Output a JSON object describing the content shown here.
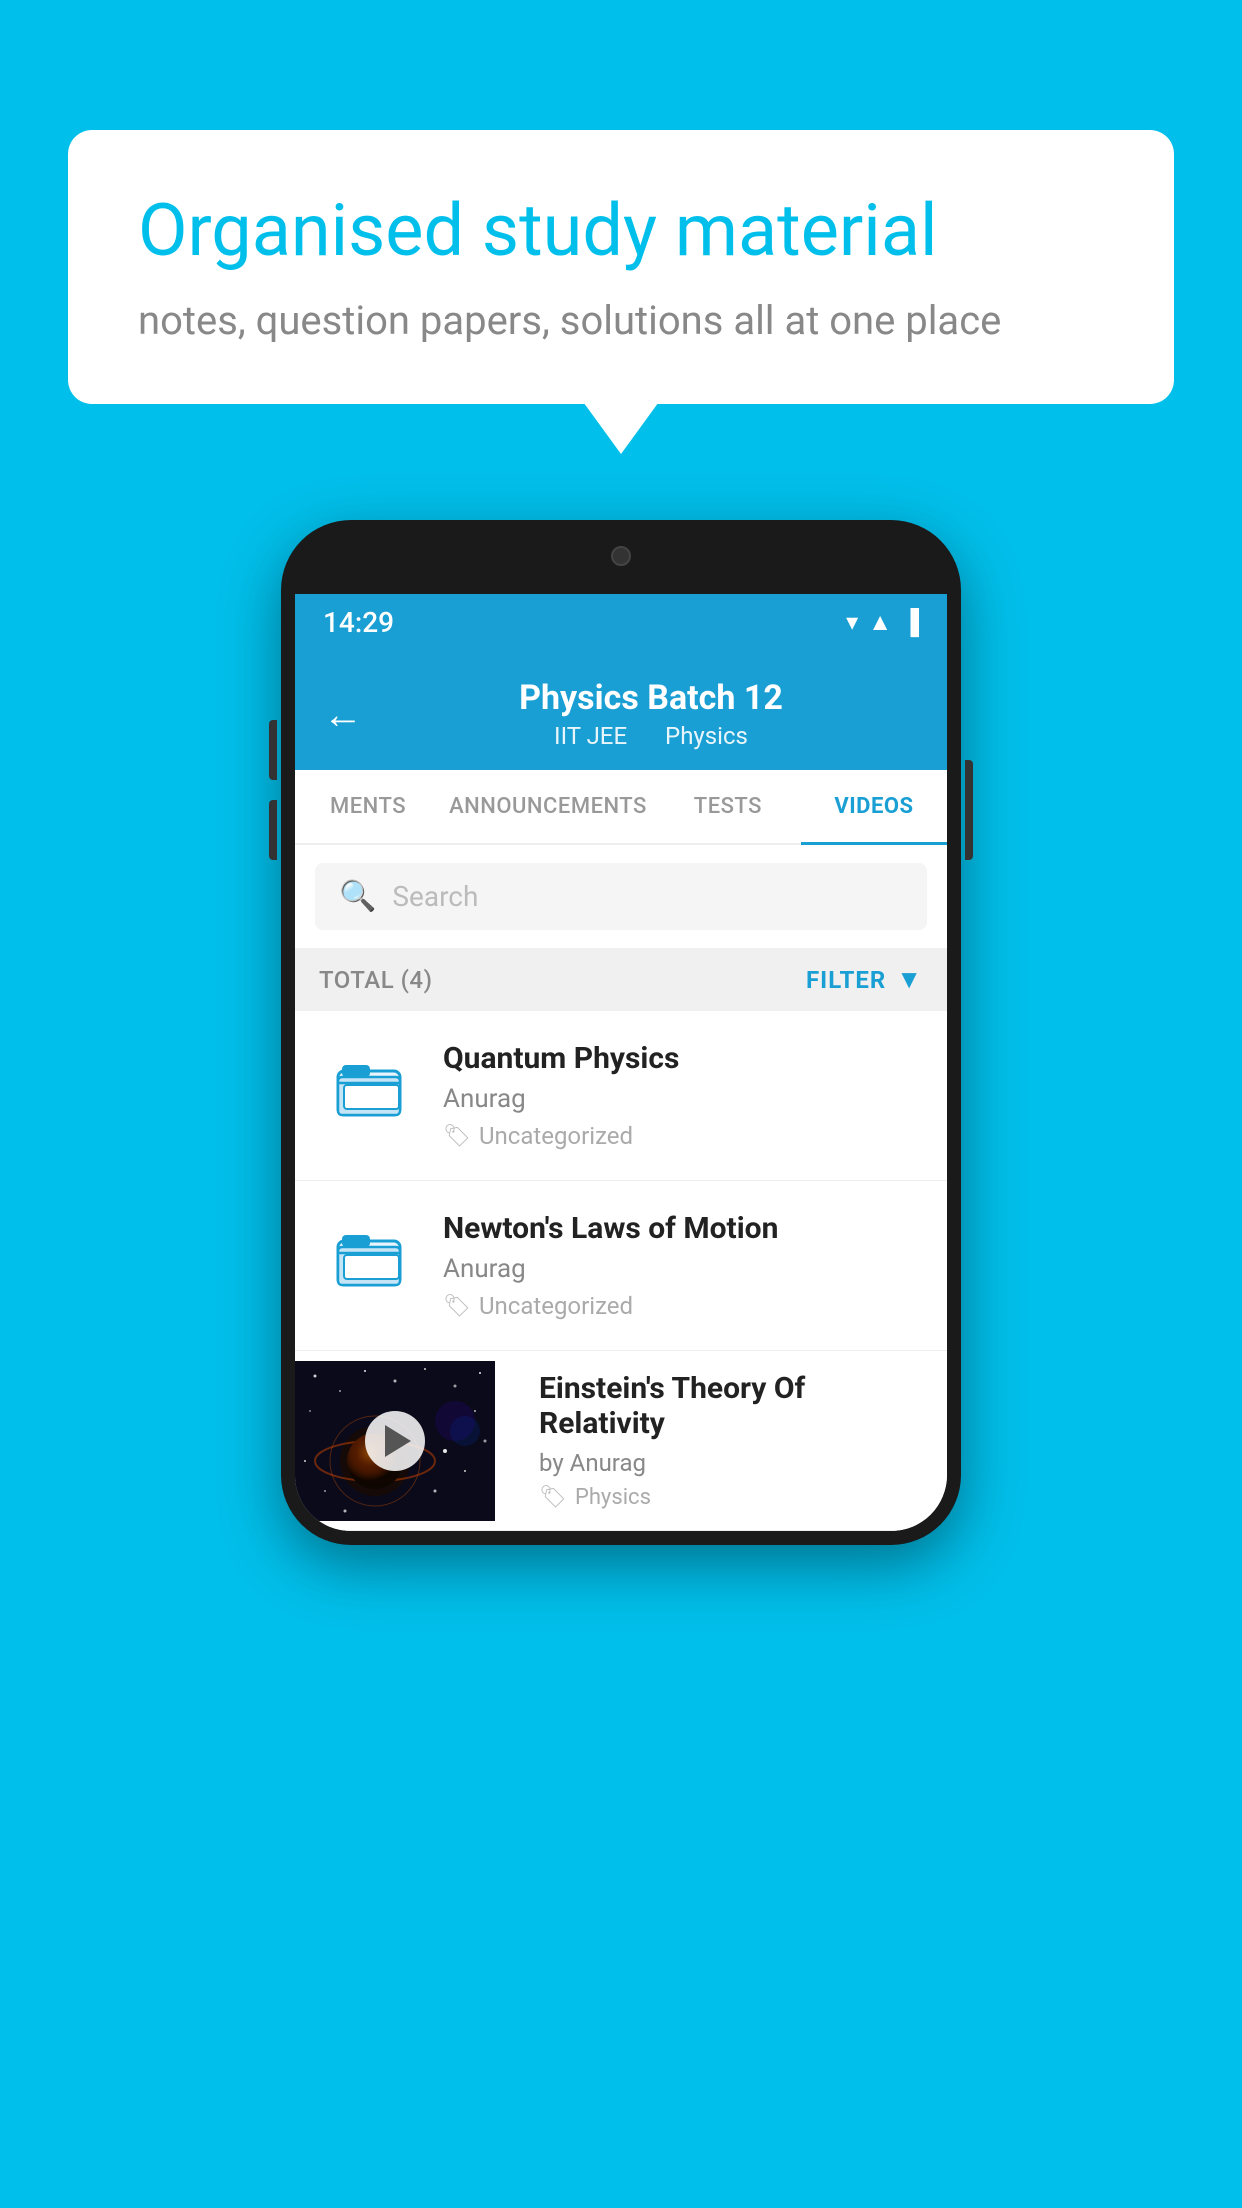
{
  "bubble": {
    "title": "Organised study material",
    "subtitle": "notes, question papers, solutions all at one place"
  },
  "status_bar": {
    "time": "14:29"
  },
  "header": {
    "back_label": "←",
    "title": "Physics Batch 12",
    "subtitle1": "IIT JEE",
    "subtitle2": "Physics"
  },
  "tabs": [
    {
      "label": "MENTS",
      "active": false
    },
    {
      "label": "ANNOUNCEMENTS",
      "active": false
    },
    {
      "label": "TESTS",
      "active": false
    },
    {
      "label": "VIDEOS",
      "active": true
    }
  ],
  "search": {
    "placeholder": "Search"
  },
  "filter": {
    "total_label": "TOTAL (4)",
    "filter_label": "FILTER"
  },
  "videos": [
    {
      "title": "Quantum Physics",
      "author": "Anurag",
      "tag": "Uncategorized",
      "type": "folder"
    },
    {
      "title": "Newton's Laws of Motion",
      "author": "Anurag",
      "tag": "Uncategorized",
      "type": "folder"
    },
    {
      "title": "Einstein's Theory Of Relativity",
      "author": "by Anurag",
      "tag": "Physics",
      "type": "video"
    }
  ]
}
